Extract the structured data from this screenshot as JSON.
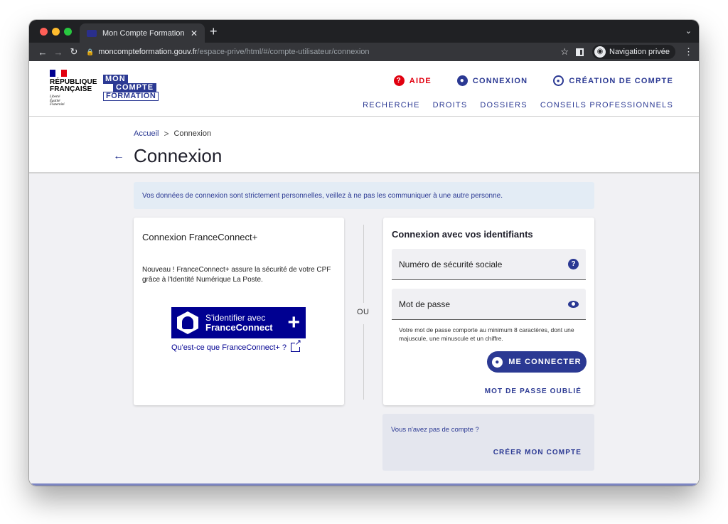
{
  "browser": {
    "tab_title": "Mon Compte Formation",
    "tab_close": "✕",
    "new_tab": "+",
    "url_host": "moncompteformation.gouv.fr",
    "url_path": "/espace-prive/html/#/compte-utilisateur/connexion",
    "incognito_label": "Navigation privée"
  },
  "header": {
    "rf_line1": "RÉPUBLIQUE",
    "rf_line2": "FRANÇAISE",
    "rf_motto": [
      "Liberté",
      "Égalité",
      "Fraternité"
    ],
    "logo_line1": "MON",
    "logo_line2": "COMPTE",
    "logo_line3": "FORMATION",
    "nav": {
      "aide": "AIDE",
      "connexion": "CONNEXION",
      "creation": "CRÉATION DE COMPTE"
    },
    "subnav": [
      "RECHERCHE",
      "DROITS",
      "DOSSIERS",
      "CONSEILS PROFESSIONNELS"
    ]
  },
  "breadcrumb": {
    "home": "Accueil",
    "separator": ">",
    "current": "Connexion"
  },
  "page_title": "Connexion",
  "notice": "Vos données de connexion sont strictement personnelles, veillez à ne pas les communiquer à une autre personne.",
  "franceconnect": {
    "title": "Connexion FranceConnect+",
    "description": "Nouveau ! FranceConnect+ assure la sécurité de votre CPF grâce à l'Identité Numérique La Poste.",
    "button_line1": "S'identifier avec",
    "button_line2": "FranceConnect",
    "button_plus": "+",
    "link": "Qu'est-ce que FranceConnect+ ?"
  },
  "separator_text": "OU",
  "credentials": {
    "title": "Connexion avec vos identifiants",
    "ssn_placeholder": "Numéro de sécurité sociale",
    "password_placeholder": "Mot de passe",
    "password_hint": "Votre mot de passe comporte au minimum 8 caractères, dont une majuscule, une minuscule et un chiffre.",
    "connect_button": "ME CONNECTER",
    "forgot_password": "MOT DE PASSE OUBLIÉ"
  },
  "no_account": {
    "question": "Vous n'avez pas de compte ?",
    "create_link": "CRÉER MON COMPTE"
  },
  "colors": {
    "brand_blue": "#2b3993",
    "france_blue": "#000091",
    "marianne_red": "#e1000f",
    "notice_bg": "#e3ecf5",
    "page_bg": "#f1f1f4"
  }
}
